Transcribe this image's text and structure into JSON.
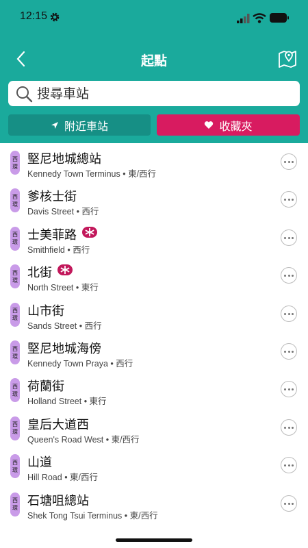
{
  "status": {
    "time": "12:15"
  },
  "header": {
    "title": "起點"
  },
  "search": {
    "placeholder": "搜尋車站"
  },
  "tabs": {
    "nearby": "附近車站",
    "favorites": "收藏夾"
  },
  "route_badge": [
    "西",
    "環"
  ],
  "stops": [
    {
      "name": "堅尼地城總站",
      "mtr": false,
      "english": "Kennedy Town Terminus",
      "direction": "東/西行"
    },
    {
      "name": "爹核士街",
      "mtr": false,
      "english": "Davis Street",
      "direction": "西行"
    },
    {
      "name": "士美菲路",
      "mtr": true,
      "english": "Smithfield",
      "direction": "西行"
    },
    {
      "name": "北街",
      "mtr": true,
      "english": "North Street",
      "direction": "東行"
    },
    {
      "name": "山市街",
      "mtr": false,
      "english": "Sands Street",
      "direction": "西行"
    },
    {
      "name": "堅尼地城海傍",
      "mtr": false,
      "english": "Kennedy Town Praya",
      "direction": "西行"
    },
    {
      "name": "荷蘭街",
      "mtr": false,
      "english": "Holland Street",
      "direction": "東行"
    },
    {
      "name": "皇后大道西",
      "mtr": false,
      "english": "Queen's Road West",
      "direction": "東/西行"
    },
    {
      "name": "山道",
      "mtr": false,
      "english": "Hill Road",
      "direction": "東/西行"
    },
    {
      "name": "石塘咀總站",
      "mtr": false,
      "english": "Shek Tong Tsui Terminus",
      "direction": "東/西行"
    }
  ],
  "colors": {
    "header": "#1aaa9c",
    "nearby": "#168f85",
    "favorites": "#d81b60",
    "badge": "#c99be8",
    "mtr": "#c2185b"
  }
}
